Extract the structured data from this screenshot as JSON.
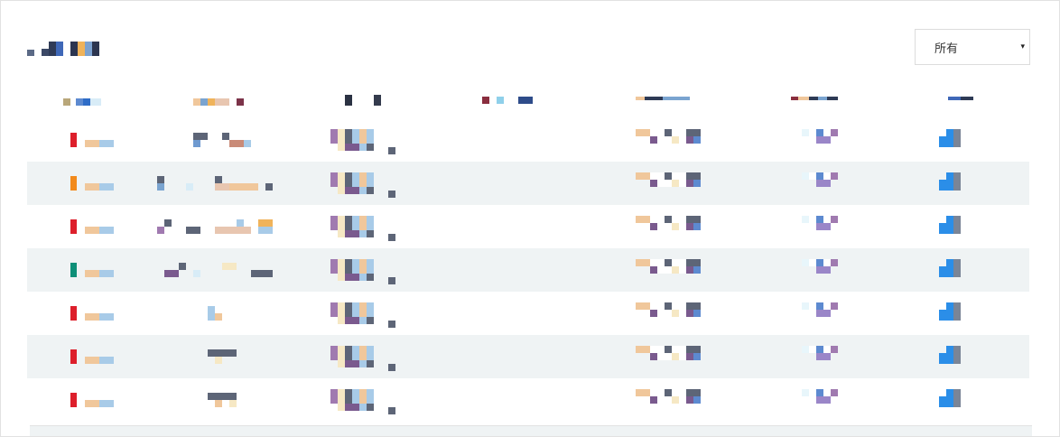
{
  "filter": {
    "selected": "所有",
    "caret": "▾"
  },
  "colors": {
    "alt_row": "#eff3f4",
    "border": "#e2e2e2",
    "priority": [
      "#dd1f2b",
      "#f28a1b",
      "#dd1f2b",
      "#0e8f78",
      "#dd1f2b",
      "#dd1f2b",
      "#dd1f2b"
    ]
  },
  "rows": [
    {
      "priority_color": "#dd1f2b",
      "alt": false
    },
    {
      "priority_color": "#f28a1b",
      "alt": true
    },
    {
      "priority_color": "#dd1f2b",
      "alt": false
    },
    {
      "priority_color": "#0e8f78",
      "alt": true
    },
    {
      "priority_color": "#dd1f2b",
      "alt": false
    },
    {
      "priority_color": "#dd1f2b",
      "alt": true
    },
    {
      "priority_color": "#dd1f2b",
      "alt": false
    }
  ]
}
